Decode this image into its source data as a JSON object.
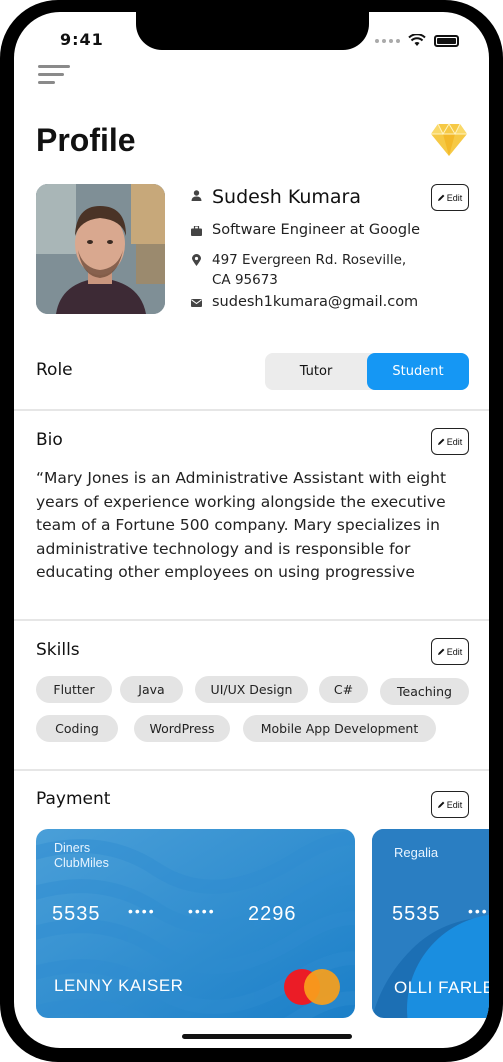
{
  "status_bar": {
    "time": "9:41"
  },
  "header": {
    "title": "Profile"
  },
  "profile": {
    "name": "Sudesh Kumara",
    "job": "Software Engineer at Google",
    "address_line1": "497 Evergreen Rd. Roseville,",
    "address_line2": "CA 95673",
    "email": "sudesh1kumara@gmail.com"
  },
  "edit_label": "Edit",
  "role": {
    "label": "Role",
    "options": [
      "Tutor",
      "Student"
    ],
    "selected": "Student"
  },
  "bio": {
    "title": "Bio",
    "text": "“Mary Jones is an Administrative Assistant with eight years of experience working alongside the executive team of a Fortune 500 company. Mary specializes in administrative technology and is responsible for educating other employees on using progressive"
  },
  "skills": {
    "title": "Skills",
    "items": [
      "Flutter",
      "Java",
      "UI/UX Design",
      "C#",
      "Teaching",
      "Coding",
      "WordPress",
      "Mobile App Development"
    ]
  },
  "payment": {
    "title": "Payment",
    "cards": [
      {
        "brand_line1": "Diners",
        "brand_line2": "ClubMiles",
        "first": "5535",
        "mask1": "••••",
        "mask2": "••••",
        "last": "2296",
        "holder": "LENNY KAISER"
      },
      {
        "brand_line1": "Regalia",
        "first": "5535",
        "mask1": "••••",
        "holder": "OLLI FARLEY"
      }
    ]
  },
  "colors": {
    "accent": "#1597f4",
    "chip_bg": "#e4e4e4",
    "diamond": "#f6c945"
  }
}
